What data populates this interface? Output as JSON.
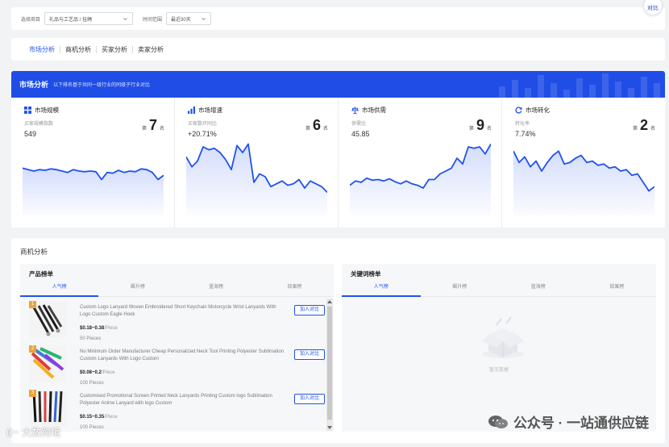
{
  "filters": {
    "category_label": "选择商目",
    "category_value": "礼品与工艺品 / 挂绳",
    "time_label": "时间范围",
    "time_value": "最近30天",
    "float_button": "对比"
  },
  "tabs": [
    {
      "label": "市场分析",
      "active": true
    },
    {
      "label": "商机分析",
      "active": false
    },
    {
      "label": "买家分析",
      "active": false
    },
    {
      "label": "卖家分析",
      "active": false
    }
  ],
  "market": {
    "title": "市场分析",
    "subtitle": "以下排名基于共同一级行业的同级子行业对比",
    "rank_prefix": "第",
    "rank_suffix": "名",
    "cards": [
      {
        "title": "市场规模",
        "icon": "grid-icon",
        "metric": "买家规模指数",
        "value": "549",
        "rank": "7",
        "series": [
          62,
          60,
          58,
          60,
          59,
          61,
          60,
          58,
          56,
          60,
          58,
          57,
          58,
          57,
          46,
          56,
          55,
          59,
          56,
          58,
          57,
          61,
          60,
          56,
          46,
          52
        ]
      },
      {
        "title": "市场增速",
        "icon": "bar-chart-icon",
        "metric": "买家数环同比",
        "value": "+20.71%",
        "rank": "6",
        "series": [
          78,
          64,
          72,
          92,
          88,
          90,
          84,
          74,
          60,
          94,
          84,
          96,
          42,
          54,
          50,
          36,
          40,
          44,
          38,
          40,
          46,
          34,
          44,
          40,
          36,
          28
        ]
      },
      {
        "title": "市场供需",
        "icon": "scale-icon",
        "metric": "供需比",
        "value": "45.85",
        "rank": "9",
        "series": [
          38,
          44,
          42,
          48,
          45,
          46,
          44,
          47,
          43,
          40,
          44,
          40,
          38,
          34,
          46,
          46,
          54,
          58,
          62,
          76,
          68,
          92,
          90,
          92,
          82,
          96
        ]
      },
      {
        "title": "市场转化",
        "icon": "refresh-icon",
        "metric": "转化率",
        "value": "7.74%",
        "rank": "2",
        "series": [
          86,
          70,
          78,
          64,
          72,
          58,
          70,
          80,
          86,
          68,
          70,
          76,
          80,
          70,
          72,
          66,
          68,
          62,
          64,
          58,
          60,
          52,
          54,
          42,
          30,
          36
        ]
      }
    ]
  },
  "biz": {
    "title": "商机分析",
    "product_panel": {
      "title": "产品榜单",
      "tabs": [
        "人气榜",
        "飙升榜",
        "蓝海榜",
        "效果榜"
      ],
      "add_label": "加入对比",
      "items": [
        {
          "rank": "1",
          "title": "Custom Logo Lanyard Woven Embroidered Short Keychain Motorcycle Wrist Lanyards With Logo Custom Eagle Hook",
          "price": "$0.18~0.38",
          "unit": "/Piece",
          "moq": "50 Pieces"
        },
        {
          "rank": "2",
          "title": "No Minimum Order Manufacturer Cheap Personalized Neck Tool Printing Polyester Sublimation Custom Lanyards With Logo Custom",
          "price": "$0.08~0.2",
          "unit": "/Piece",
          "moq": "100 Pieces"
        },
        {
          "rank": "3",
          "title": "Customised Promotional Screen Printed Neck Lanyards Printing Custom logo Sublimation Polyester Anime Lanyard with logo Custom",
          "price": "$0.15~0.35",
          "unit": "/Piece",
          "moq": "100 Pieces"
        }
      ]
    },
    "keyword_panel": {
      "title": "关键词榜单",
      "tabs": [
        "人气榜",
        "飙升榜",
        "蓝海榜",
        "效果榜"
      ],
      "empty_text": "暂无数据"
    }
  },
  "watermarks": {
    "right": "公众号 · 一站通供应链",
    "left": "大数跨境",
    "left_logo": "((◦◦"
  },
  "colors": {
    "accent": "#1f52f0",
    "banner": "#1f4de6",
    "badge": "#e9a53a"
  }
}
